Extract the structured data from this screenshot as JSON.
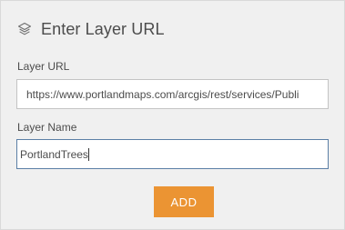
{
  "header": {
    "icon": "layers-icon",
    "title": "Enter Layer URL"
  },
  "url_field": {
    "label": "Layer URL",
    "value": "https://www.portlandmaps.com/arcgis/rest/services/Publi"
  },
  "name_field": {
    "label": "Layer Name",
    "value": "PortlandTrees"
  },
  "add_button": {
    "label": "ADD"
  },
  "colors": {
    "panel_bg": "#f0f0f0",
    "button_bg": "#eb9433",
    "focus_border": "#5b7fa6"
  }
}
